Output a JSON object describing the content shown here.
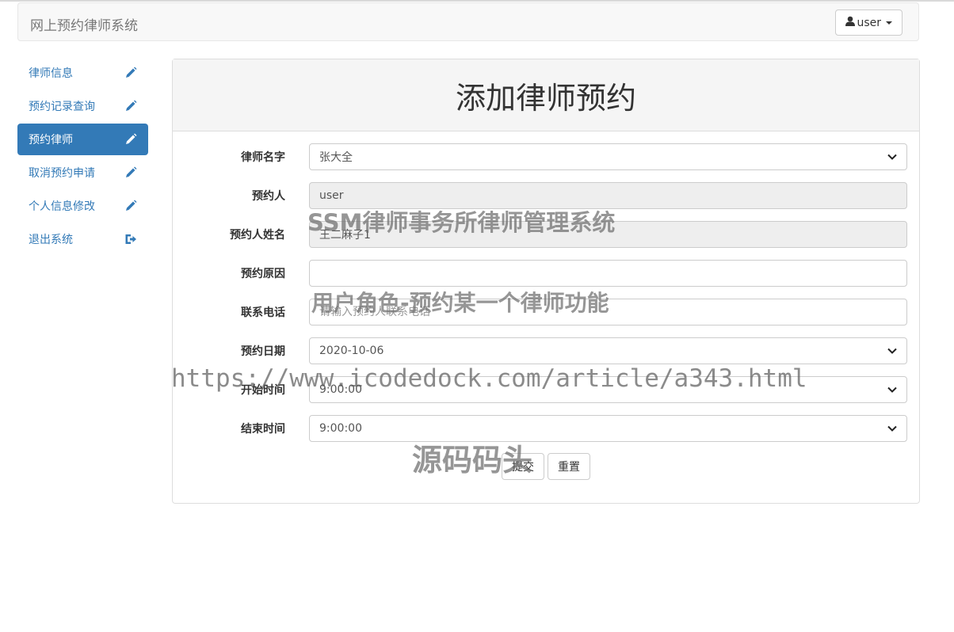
{
  "navbar": {
    "brand": "网上预约律师系统",
    "user_label": "user"
  },
  "sidebar": {
    "items": [
      {
        "label": "律师信息",
        "icon": "pencil-icon",
        "active": false
      },
      {
        "label": "预约记录查询",
        "icon": "pencil-icon",
        "active": false
      },
      {
        "label": "预约律师",
        "icon": "pencil-icon",
        "active": true
      },
      {
        "label": "取消预约申请",
        "icon": "pencil-icon",
        "active": false
      },
      {
        "label": "个人信息修改",
        "icon": "pencil-icon",
        "active": false
      },
      {
        "label": "退出系统",
        "icon": "logout-icon",
        "active": false
      }
    ]
  },
  "panel": {
    "title": "添加律师预约"
  },
  "form": {
    "lawyer_name": {
      "label": "律师名字",
      "value": "张大全"
    },
    "booker": {
      "label": "预约人",
      "value": "user"
    },
    "booker_name": {
      "label": "预约人姓名",
      "value": "王二麻子1"
    },
    "reason": {
      "label": "预约原因",
      "value": ""
    },
    "phone": {
      "label": "联系电话",
      "placeholder": "请输入预约人联系电话"
    },
    "date": {
      "label": "预约日期",
      "value": "2020-10-06"
    },
    "start_time": {
      "label": "开始时间",
      "value": "9:00:00"
    },
    "end_time": {
      "label": "结束时间",
      "value": "9:00:00"
    },
    "submit_label": "提交",
    "reset_label": "重置"
  },
  "watermarks": {
    "line1": "SSM律师事务所律师管理系统",
    "line2": "用户角色-预约某一个律师功能",
    "line3": "https://www.icodedock.com/article/a343.html",
    "line4": "源码码头"
  },
  "colors": {
    "primary": "#337ab7",
    "readonly_bg": "#eeeeee",
    "panel_head_bg": "#f5f5f5"
  }
}
